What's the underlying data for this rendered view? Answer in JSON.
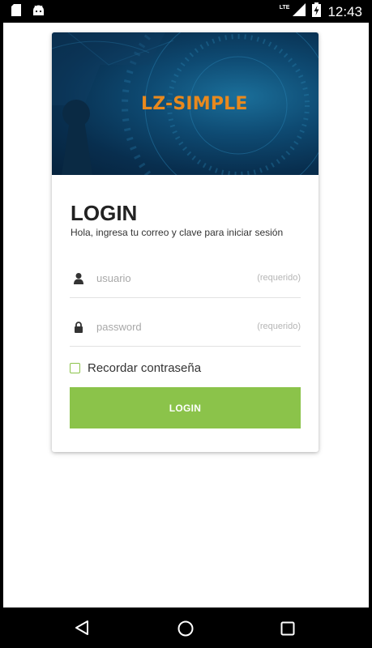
{
  "status_bar": {
    "time": "12:43",
    "network": "LTE",
    "icons": [
      "sd-card-icon",
      "android-icon",
      "signal-icon",
      "battery-charging-icon"
    ]
  },
  "banner": {
    "brand": "LZ-SIMPLE",
    "brand_color": "#e8891e"
  },
  "login": {
    "title": "LOGIN",
    "subtitle": "Hola, ingresa tu correo y clave para iniciar sesión",
    "username": {
      "placeholder": "usuario",
      "hint": "(requerido)",
      "icon": "user-icon"
    },
    "password": {
      "placeholder": "password",
      "hint": "(requerido)",
      "icon": "lock-icon"
    },
    "remember_label": "Recordar contraseña",
    "remember_checked": false,
    "button_label": "LOGIN",
    "accent_color": "#8bc34a"
  },
  "nav_bar": {
    "buttons": [
      "back-icon",
      "home-icon",
      "recents-icon"
    ]
  }
}
